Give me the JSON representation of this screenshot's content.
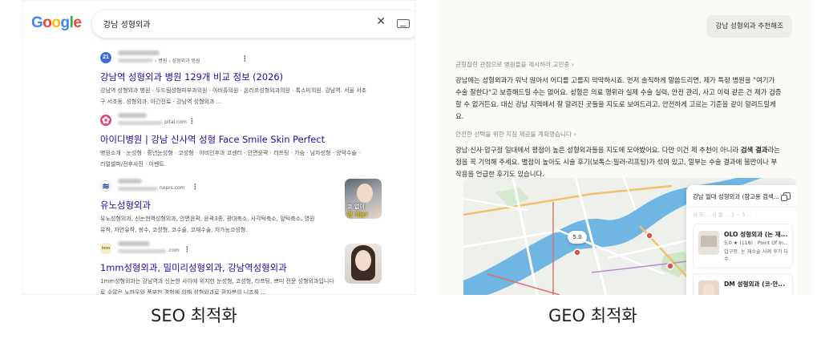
{
  "seo": {
    "logo": "Google",
    "logo_colors": [
      "#4285F4",
      "#EA4335",
      "#FBBC05",
      "#4285F4",
      "#34A853",
      "#EA4335"
    ],
    "query": "강남 성형외과",
    "results": [
      {
        "favicon": "21",
        "favicon_color": "#3b6fd8",
        "url_tail": "› 병원 › 성형외과 병원",
        "title": "강남역 성형외과 병원 129개 비교 정보 (2026)",
        "snippet_1": "강남역 성형외과 병원 · 두드림성형피부과의원 · 아비쥬의원 · 온리프성형외과의원 · 톡스미의원. 강남역. 서울 서초",
        "snippet_2": "구 서초동. 성형외과. 아간진료 · 강남역 성형외과 ..."
      },
      {
        "favicon": "✿",
        "favicon_color": "#e0457b",
        "url_tail": "pital.com",
        "title": "아이디병원 | 강남 신사역 성형 Face Smile Skin Perfect",
        "snippet_1": "병원소개 · 눈성형 · 증년눈성형 · 코성형 · 이비인후과 코센터 · 안면윤곽 · 리프팅 · 가슴 · 남자성형 · 양악수술 ·",
        "snippet_2": "리얼셀피/전후사진 · 이벤트."
      },
      {
        "favicon": "≋",
        "favicon_color": "#1f3f8f",
        "url_tail": "noprs.com",
        "title": "유노성형외과",
        "snippet_1": "유노성형외과, 신논현역성형외과, 안면윤곽, 윤곽3종, 광대축소, 사각턱축소, 앞턱축소, 영원",
        "snippet_2": "유착, 자연유착, 쌍수, 코성형, 코수술, 코재수술, 지가능코성형.",
        "thumb_caption_1": "코 없이",
        "thumb_caption_2": "경 가능?"
      },
      {
        "favicon": "Imm",
        "favicon_color": "#c8b23c",
        "url_tail": ".com",
        "title": "1mm성형외과, 밀미리성형외과, 강남역성형외과",
        "snippet_1": "1mm성형외과는 강남역과 신논현 사이에 위치한 눈성형, 코성형, 리프팅, 쁘띠 전문 성형외과입니다",
        "snippet_2": "로 수많은 노하우와 풍부한 경험에 의해 성형외과로 환자분의 니즈를 ..."
      }
    ]
  },
  "geo": {
    "chip": "강남 성형외과 추천해조",
    "step_1": "균형잡힌 관점으로 병원들을 제시하려 고민중 ›",
    "para_1": "강남에는 성형외과가 워낙 많아서 어디를 고를지 막막하시죠. 먼저 솔직하게 말씀드리면, 제가 특정 병원을 \"여기가 수술 잘한다\"고 보증해드릴 수는 없어요. 성형은 의료 행위라 실제 수술 실력, 안전 관리, 사고 이력 같은 건 제가 검증할 수 없거든요. 대신 강남 지역에서 잘 알려진 곳들을 지도로 보여드리고, 안전하게 고르는 기준을 같이 알려드릴게요.",
    "step_2": "안전한 선택을 위한 지침 제공을 계획했습니다 ›",
    "para_2_a": "강남·신사·압구정 일대에서 평점이 높은 성형외과들을 지도에 모아봤어요. 다만 이건 제 추천이 아니라 ",
    "para_2_b": "검색 결과",
    "para_2_c": "라는 점을 꼭 기억해 주세요. 별점이 높아도 시술 후기(보톡스·필러·리프팅)가 섞여 있고, 일부는 수술 결과에 불만이나 부작용을 언급한 후기도 있습니다.",
    "map_rating": "5.0",
    "places_title": "강남 일대 성형외과 (참고용 검색...",
    "places_faded": "서 도 ... 시 들 ... 1 ~ 5 ..."
  },
  "places": [
    {
      "name": "OLO 성형외과 (논 재...",
      "rating": "5.0 ★ (118) · Point Of In...",
      "desc": "압구정. 눈 재수술 사례 후기 다수."
    },
    {
      "name": "DM 성형외과 (코·안...",
      "rating": "",
      "desc": ""
    }
  ],
  "captions": {
    "left": "SEO 최적화",
    "right": "GEO 최적화"
  }
}
